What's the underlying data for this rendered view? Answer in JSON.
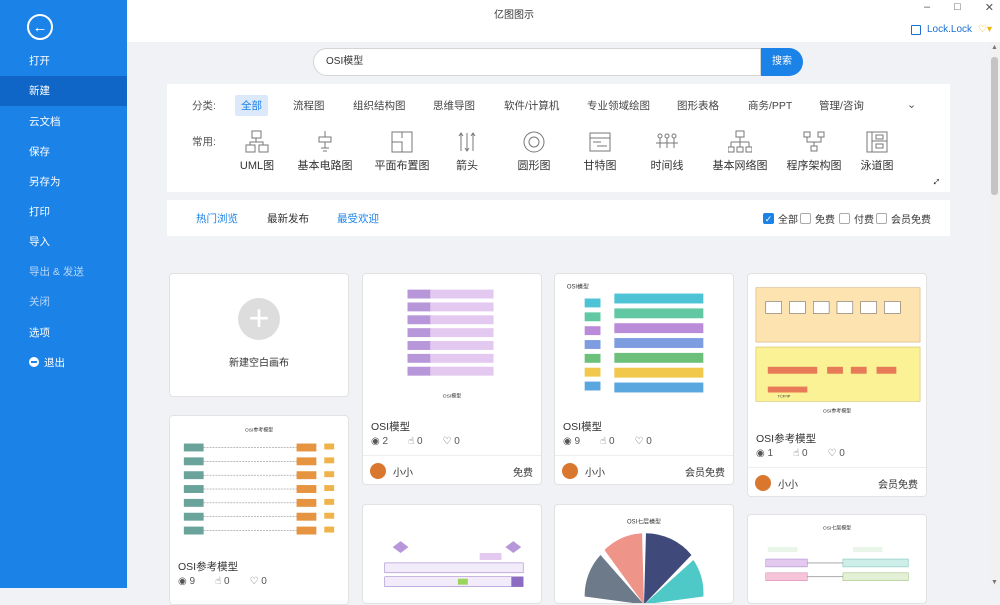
{
  "sidebar": {
    "items": [
      "打开",
      "新建",
      "云文档",
      "保存",
      "另存为",
      "打印",
      "导入",
      "导出 & 发送",
      "关闭",
      "选项",
      "退出"
    ]
  },
  "window": {
    "title": "亿图图示",
    "user": "Lock.Lock"
  },
  "search": {
    "value": "OSI模型",
    "button": "搜索"
  },
  "categories": {
    "label": "分类:",
    "items": [
      "全部",
      "流程图",
      "组织结构图",
      "思维导图",
      "软件/计算机",
      "专业领域绘图",
      "图形表格",
      "商务/PPT",
      "管理/咨询"
    ]
  },
  "common": {
    "label": "常用:",
    "items": [
      "UML图",
      "基本电路图",
      "平面布置图",
      "箭头",
      "圆形图",
      "甘特图",
      "时间线",
      "基本网络图",
      "程序架构图",
      "泳道图"
    ]
  },
  "tabs": [
    "热门浏览",
    "最新发布",
    "最受欢迎"
  ],
  "filters": [
    "全部",
    "免费",
    "付费",
    "会员免费"
  ],
  "cards": [
    {
      "name": "新建空白画布"
    },
    {
      "name": "OSI模型",
      "views": "2",
      "likes": "0",
      "favs": "0",
      "author": "小小",
      "price": "免费",
      "img_title": "OSI模型"
    },
    {
      "name": "OSI模型",
      "views": "9",
      "likes": "0",
      "favs": "0",
      "author": "小小",
      "price": "会员免费",
      "img_title": "OSI模型"
    },
    {
      "name": "OSI参考模型",
      "views": "1",
      "likes": "0",
      "favs": "0",
      "author": "小小",
      "price": "会员免费",
      "img_title": "OSI参考模型",
      "img_sub": "TCP/IP"
    },
    {
      "name": "OSI参考模型",
      "views": "9",
      "likes": "0",
      "favs": "0",
      "img_title": "OSI参考模型"
    },
    {
      "img_title": "OSI七层模型"
    },
    {
      "img_title": "OSI七层模型"
    }
  ]
}
